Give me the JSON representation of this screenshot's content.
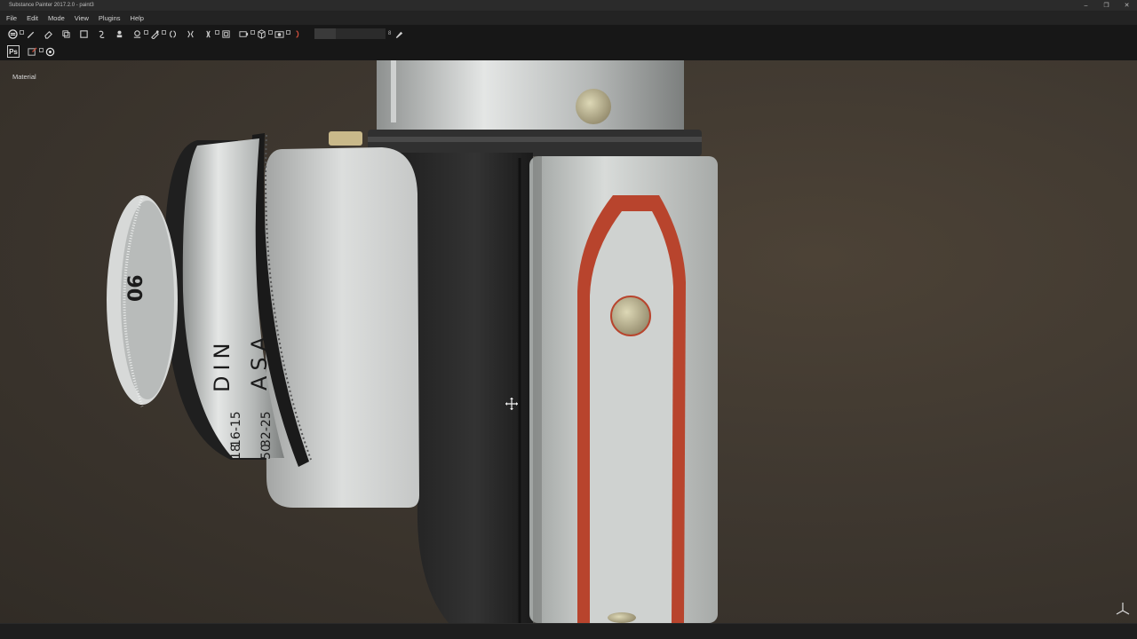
{
  "window": {
    "title": "Substance Painter 2017.2.0 - paint3",
    "controls": {
      "minimize": "–",
      "restore": "❐",
      "close": "✕"
    }
  },
  "menu": {
    "items": [
      "File",
      "Edit",
      "Mode",
      "View",
      "Plugins",
      "Help"
    ]
  },
  "toolbar": {
    "brush_size_value": "8",
    "brush_size_fraction": 0.3
  },
  "toolbar2": {
    "photoshop_label": "Ps"
  },
  "viewport": {
    "mode_label": "Material",
    "dial_labels": {
      "number": "06",
      "din": "DIN",
      "asa": "ASA",
      "scale1": "16-15",
      "scale2": "32-25",
      "scale3": "18",
      "scale4": "50"
    }
  },
  "colors": {
    "accent": "#e8e8e8",
    "background": "#3a332c",
    "chrome": "#c9ccca",
    "leather": "#262626",
    "red_stripe": "#b8442d"
  }
}
